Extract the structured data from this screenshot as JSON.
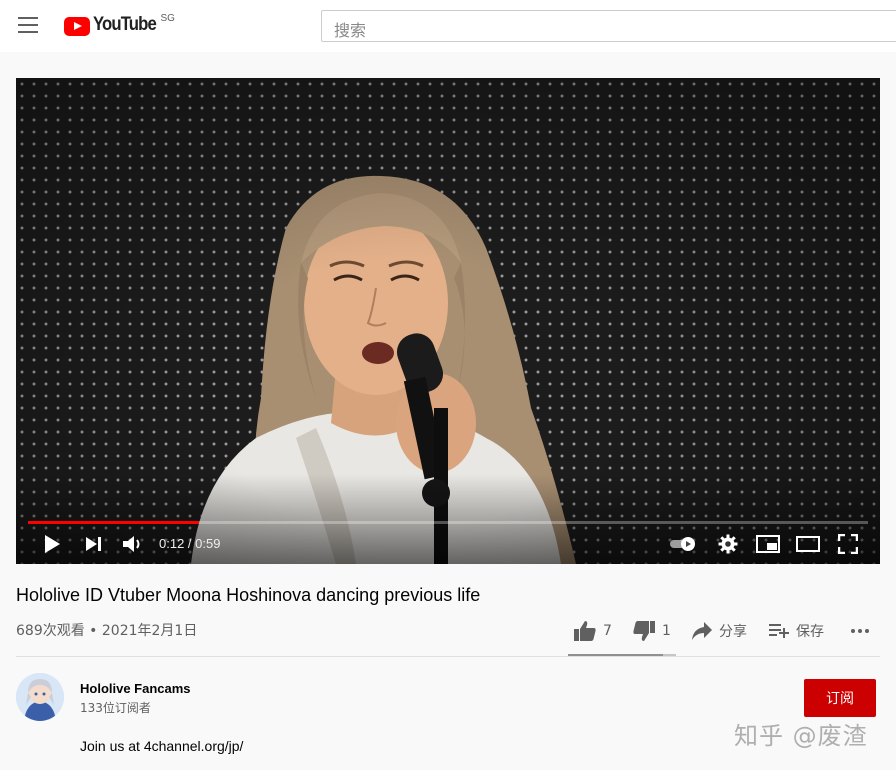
{
  "header": {
    "logo_text": "YouTube",
    "country_code": "SG",
    "search_placeholder": "搜索"
  },
  "player": {
    "current_time": "0:12",
    "duration": "0:59",
    "progress_fraction": 0.203,
    "time_display": "0:12 / 0:59",
    "accent_color": "#ff0000"
  },
  "video": {
    "title": "Hololive ID Vtuber Moona Hoshinova dancing previous life",
    "views": "689次观看",
    "separator": " • ",
    "date": "2021年2月1日",
    "meta_line": "689次观看 • 2021年2月1日"
  },
  "actions": {
    "likes": "7",
    "dislikes": "1",
    "share_label": "分享",
    "save_label": "保存",
    "like_fraction": 0.875
  },
  "channel": {
    "name": "Hololive Fancams",
    "subscribers": "133位订阅者",
    "subscribe_label": "订阅",
    "subscribe_color": "#cc0000",
    "description": "Join us at 4channel.org/jp/"
  },
  "watermark": {
    "text": "知乎 @废渣"
  }
}
